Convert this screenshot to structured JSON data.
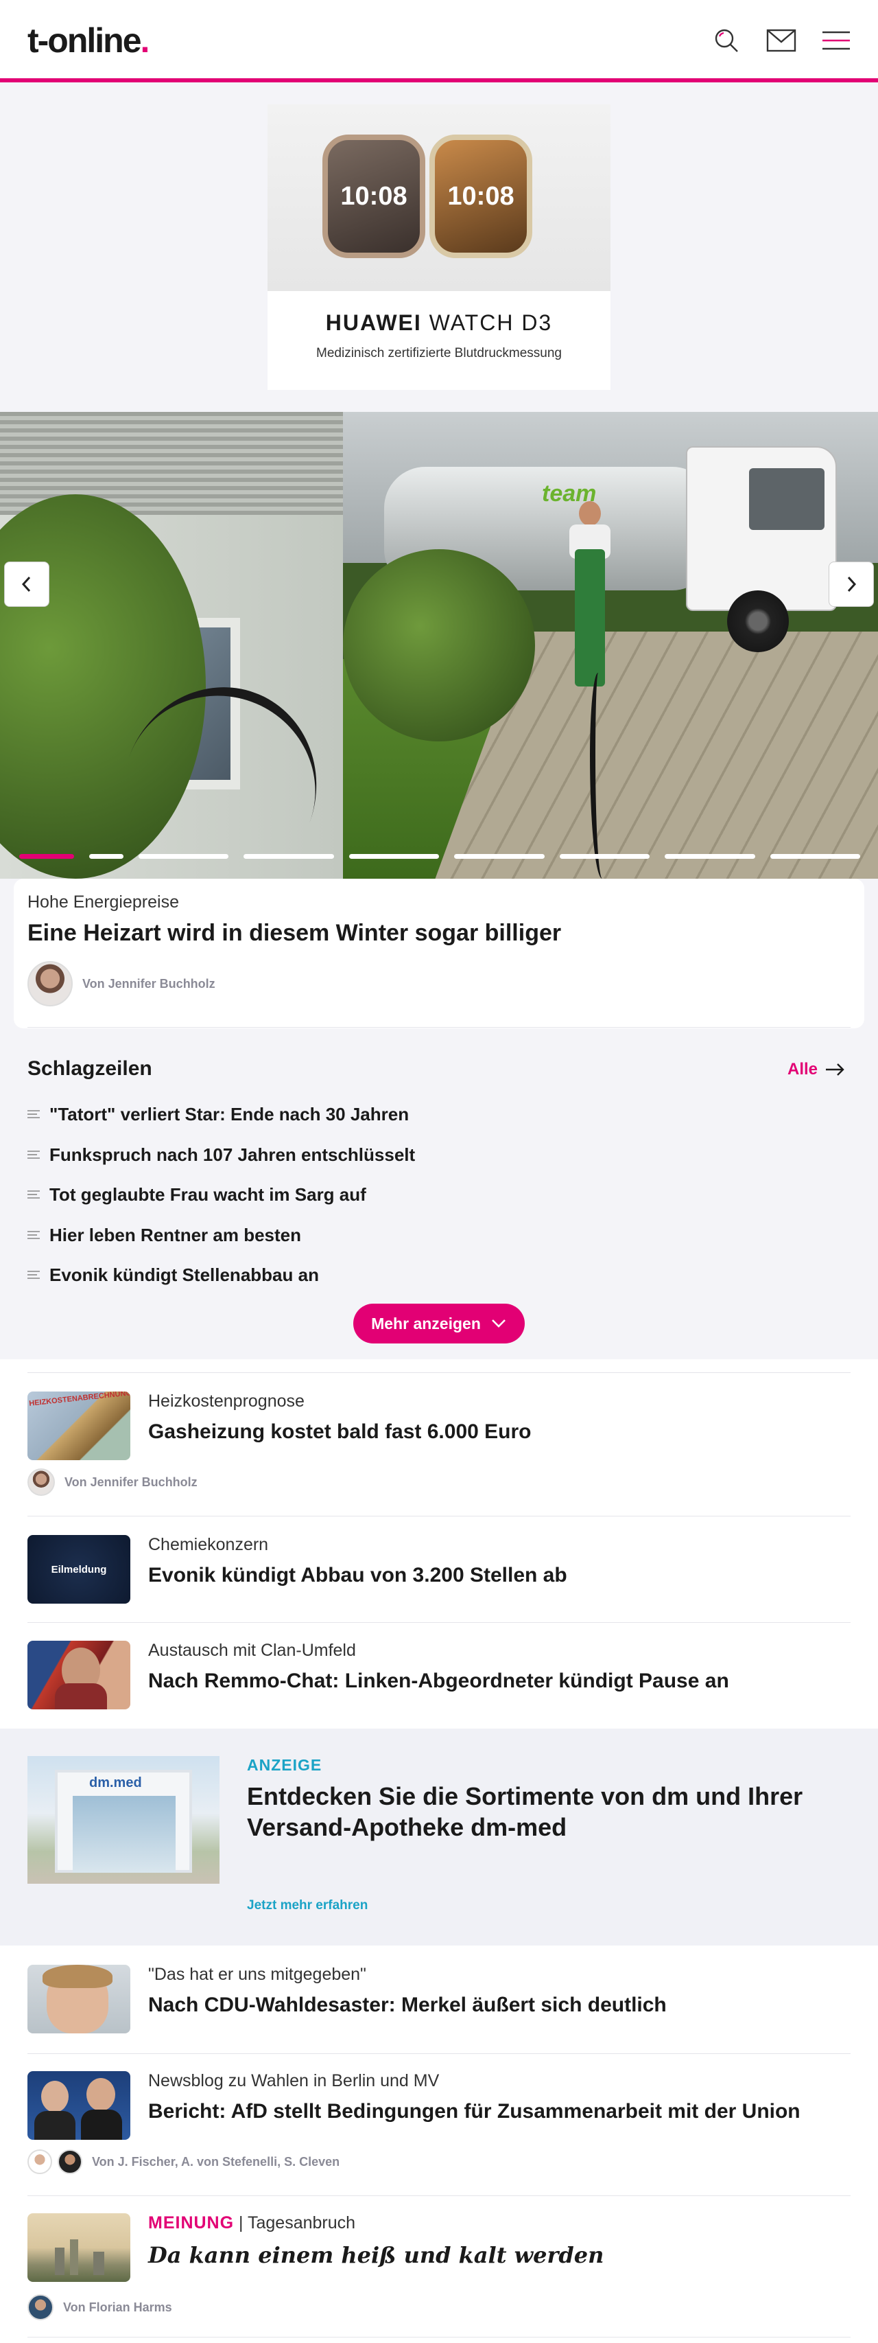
{
  "header": {
    "logo_text": "t-online",
    "logo_dot": ".",
    "icons": [
      "search-icon",
      "mail-icon",
      "menu-icon"
    ],
    "accent_color": "#e20074"
  },
  "ad_banner": {
    "brand": "HUAWEI WATCH D3",
    "brand_part1": "HUAWEI",
    "brand_part2": "WATCH D3",
    "subtitle": "Medizinisch zertifizierte Blutdruckmessung",
    "watch1_time": "10:08",
    "watch2_time": "10:08"
  },
  "hero": {
    "truck_logo": "team",
    "slide_count": 9,
    "active_slide": 1,
    "kicker": "Hohe Energiepreise",
    "headline": "Eine Heizart wird in diesem Winter sogar billiger",
    "author": "Von Jennifer Buchholz"
  },
  "headlines": {
    "title": "Schlagzeilen",
    "all_label": "Alle",
    "items": [
      "\"Tatort\" verliert Star: Ende nach 30 Jahren",
      "Funkspruch nach 107 Jahren entschlüsselt",
      "Tot geglaubte Frau wacht im Sarg auf",
      "Hier leben Rentner am besten",
      "Evonik kündigt Stellenabbau an"
    ],
    "more_label": "Mehr anzeigen"
  },
  "teasers": [
    {
      "kicker": "Heizkostenprognose",
      "headline": "Gasheizung kostet bald fast 6.000 Euro",
      "author": "Von Jennifer Buchholz",
      "thumb_text": "HEIZKOSTENABRECHNUNG"
    },
    {
      "kicker": "Chemiekonzern",
      "headline": "Evonik kündigt Abbau von 3.200 Stellen ab",
      "thumb_text": "Eilmeldung"
    },
    {
      "kicker": "Austausch mit Clan-Umfeld",
      "headline": "Nach Remmo-Chat: Linken-Abgeordneter kündigt Pause an"
    }
  ],
  "ad_block": {
    "label": "ANZEIGE",
    "headline": "Entdecken Sie die Sortimente von dm und Ihrer Versand-Apotheke dm-med",
    "cta": "Jetzt mehr erfahren",
    "thumb_text": "dm.med",
    "label_color": "#1ba3c6"
  },
  "more_teasers": [
    {
      "kicker": "\"Das hat er uns mitgegeben\"",
      "headline": "Nach CDU-Wahldesaster: Merkel äußert sich deutlich"
    },
    {
      "kicker": "Newsblog zu Wahlen in Berlin und MV",
      "headline": "Bericht: AfD stellt Bedingungen für Zusammenarbeit mit der Union",
      "author": "Von J. Fischer, A. von Stefenelli, S. Cleven"
    },
    {
      "kicker_meinung": "MEINUNG",
      "kicker_sep": " | ",
      "kicker": "Tagesanbruch",
      "headline": "Da kann einem heiß und kalt werden",
      "author": "Von Florian Harms"
    }
  ]
}
